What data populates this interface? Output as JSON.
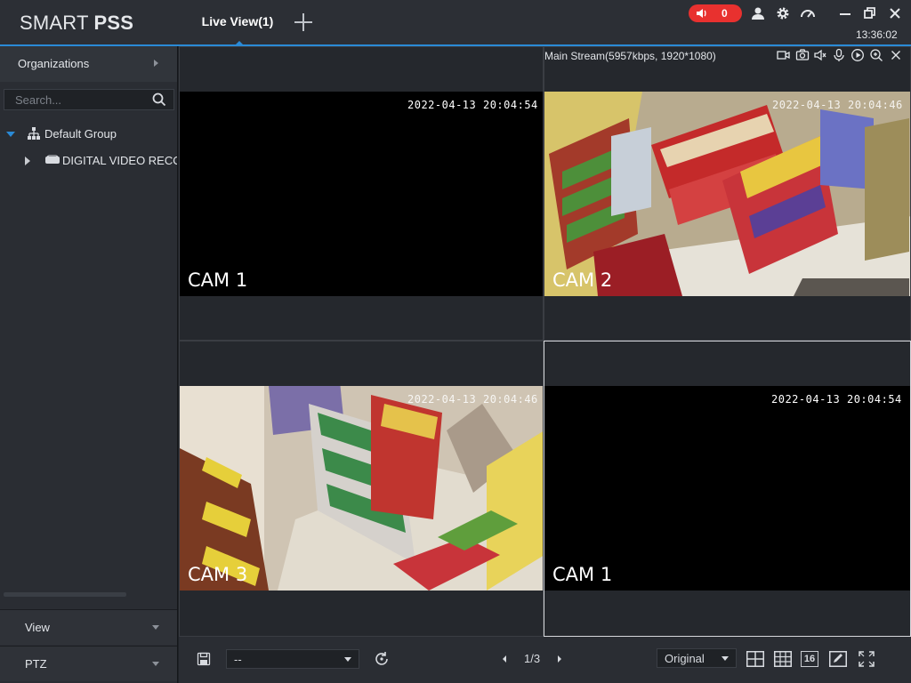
{
  "header": {
    "logo_light": "SMART ",
    "logo_bold": "PSS",
    "tab_label": "Live View(1)",
    "alarm_count": "0",
    "clock": "13:36:02",
    "accent_color": "#2a8ad6",
    "alarm_color": "#e8312f"
  },
  "sidebar": {
    "organizations_label": "Organizations",
    "search_placeholder": "Search...",
    "tree": {
      "group_label": "Default Group",
      "device_label": "DIGITAL VIDEO RECORDER"
    },
    "view_label": "View",
    "ptz_label": "PTZ"
  },
  "grid": {
    "cells": [
      {
        "timestamp": "2022-04-13 20:04:54",
        "cam": "CAM 1"
      },
      {
        "timestamp": "2022-04-13 20:04:46",
        "cam": "CAM 2",
        "stream_info": "Main Stream(5957kbps, 1920*1080)"
      },
      {
        "timestamp": "2022-04-13 20:04:46",
        "cam": "CAM 3"
      },
      {
        "timestamp": "2022-04-13 20:04:54",
        "cam": "CAM 1"
      }
    ]
  },
  "bottombar": {
    "view_select_value": "--",
    "page_indicator": "1/3",
    "ratio_select_value": "Original",
    "layout_16_label": "16"
  }
}
